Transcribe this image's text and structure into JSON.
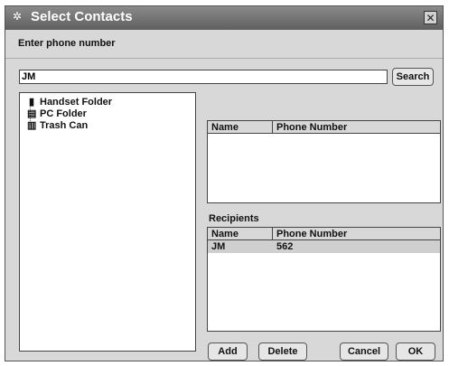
{
  "window": {
    "title": "Select Contacts",
    "close_symbol": "✕"
  },
  "subtitle": "Enter phone number",
  "search": {
    "value": "JM",
    "button_label": "Search"
  },
  "tree": {
    "items": [
      {
        "label": "Handset Folder",
        "icon": "handset-icon"
      },
      {
        "label": "PC Folder",
        "icon": "pc-icon"
      },
      {
        "label": "Trash Can",
        "icon": "trash-icon"
      }
    ]
  },
  "results_table": {
    "columns": [
      "Name",
      "Phone Number"
    ],
    "rows": []
  },
  "recipients": {
    "label": "Recipients",
    "columns": [
      "Name",
      "Phone Number"
    ],
    "rows": [
      {
        "name": "JM",
        "phone": "562"
      }
    ]
  },
  "buttons": {
    "add": "Add",
    "delete": "Delete",
    "cancel": "Cancel",
    "ok": "OK"
  }
}
